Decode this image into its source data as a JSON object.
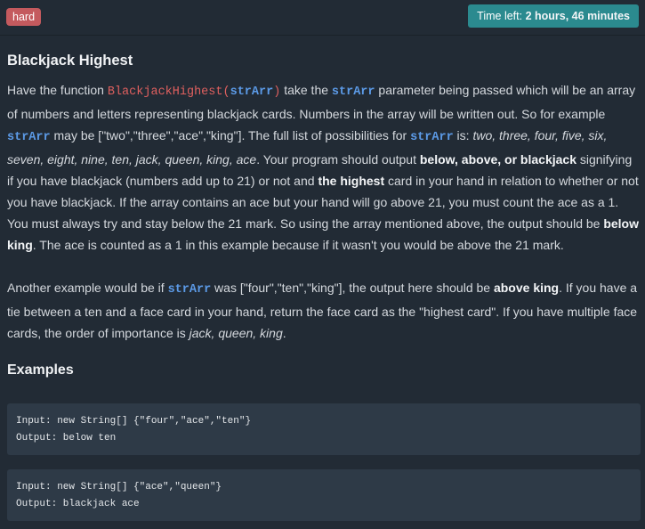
{
  "header": {
    "difficulty": "hard",
    "time_prefix": "Time left: ",
    "time_value": "2 hours, 46 minutes"
  },
  "problem": {
    "title": "Blackjack Highest",
    "fn_name": "BlackjackHighest(",
    "fn_arg": "strArr",
    "fn_close": ")",
    "arg": "strArr",
    "p1": {
      "t1": "Have the function ",
      "t2": " take the ",
      "t3": " parameter being passed which will be an array of numbers and letters representing blackjack cards. Numbers in the array will be written out. So for example ",
      "t4": " may be [\"two\",\"three\",\"ace\",\"king\"]. The full list of possibilities for ",
      "t5": " is: ",
      "list": "two, three, four, five, six, seven, eight, nine, ten, jack, queen, king, ace",
      "t6": ". Your program should output ",
      "b1": "below, above, or blackjack",
      "t7": " signifying if you have blackjack (numbers add up to 21) or not and ",
      "b2": "the highest",
      "t8": " card in your hand in relation to whether or not you have blackjack. If the array contains an ace but your hand will go above 21, you must count the ace as a 1. You must always try and stay below the 21 mark. So using the array mentioned above, the output should be ",
      "b3": "below king",
      "t9": ". The ace is counted as a 1 in this example because if it wasn't you would be above the 21 mark."
    },
    "p2": {
      "t1": "Another example would be if ",
      "t2": " was [\"four\",\"ten\",\"king\"], the output here should be ",
      "b1": "above king",
      "t3": ". If you have a tie between a ten and a face card in your hand, return the face card as the \"highest card\". If you have multiple face cards, the order of importance is ",
      "order": "jack, queen, king",
      "t4": "."
    }
  },
  "examples": {
    "heading": "Examples",
    "items": [
      {
        "input": "Input: new String[] {\"four\",\"ace\",\"ten\"}",
        "output": "Output: below ten"
      },
      {
        "input": "Input: new String[] {\"ace\",\"queen\"}",
        "output": "Output: blackjack ace"
      }
    ]
  }
}
